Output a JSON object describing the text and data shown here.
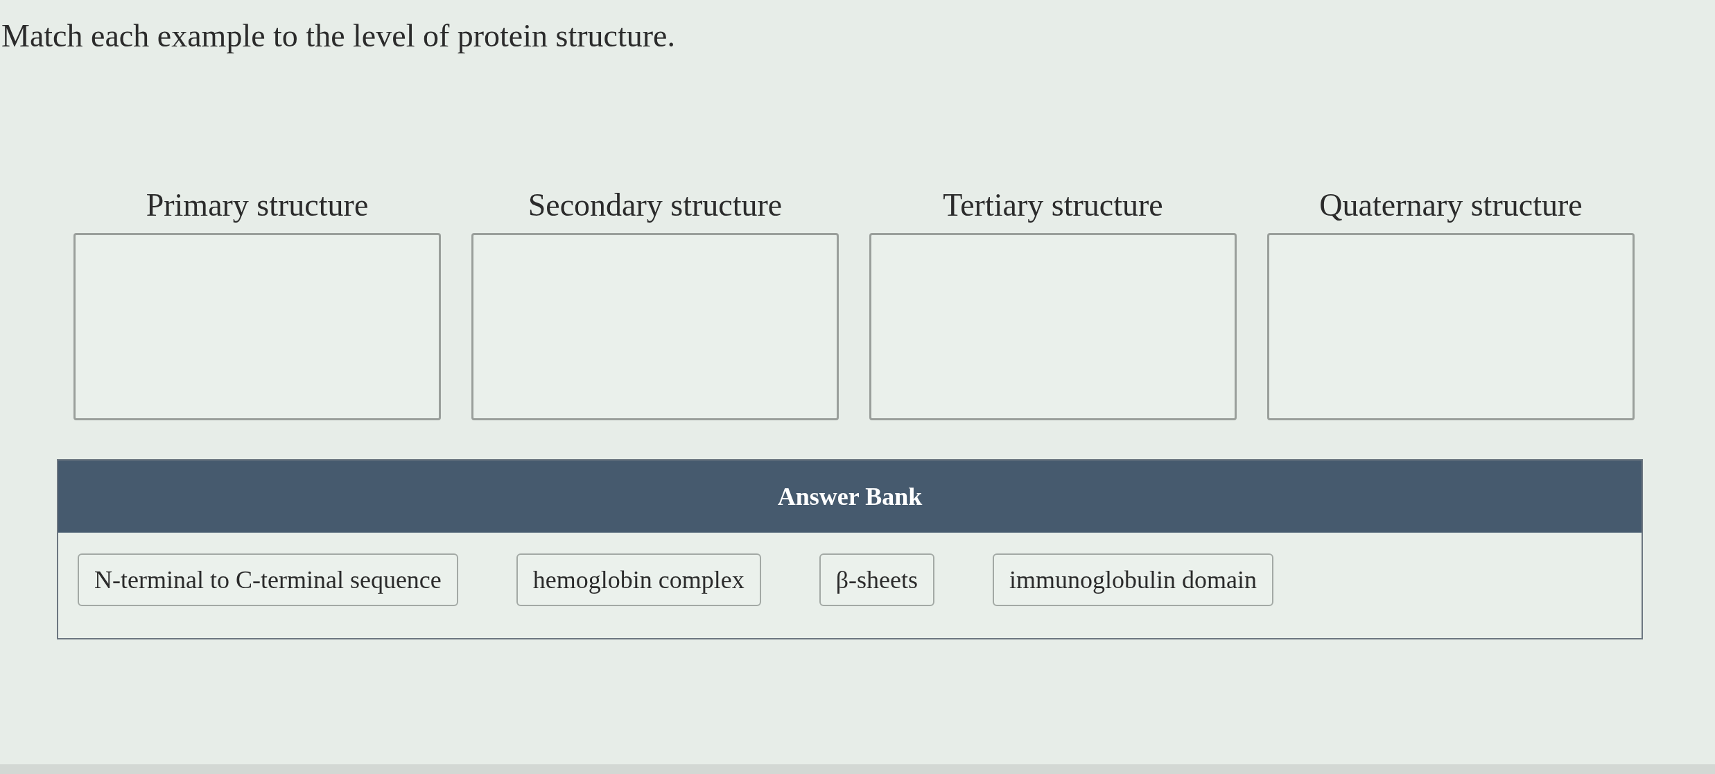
{
  "prompt": "Match each example to the level of protein structure.",
  "targets": [
    {
      "label": "Primary structure"
    },
    {
      "label": "Secondary structure"
    },
    {
      "label": "Tertiary structure"
    },
    {
      "label": "Quaternary structure"
    }
  ],
  "answer_bank": {
    "title": "Answer Bank",
    "items": [
      "N-terminal to C-terminal sequence",
      "hemoglobin complex",
      "β-sheets",
      "immunoglobulin domain"
    ]
  }
}
